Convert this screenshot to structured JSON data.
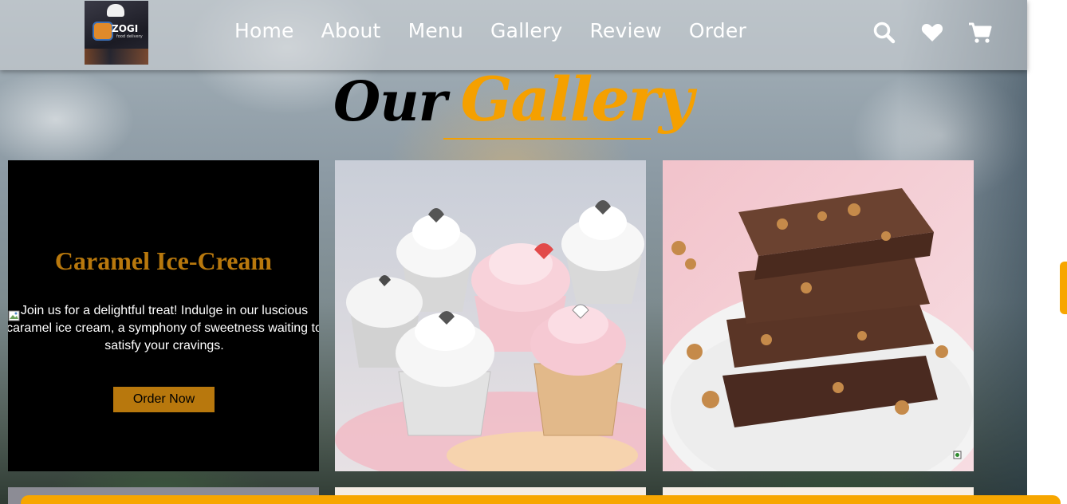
{
  "nav": {
    "links": [
      "Home",
      "About",
      "Menu",
      "Gallery",
      "Review",
      "Order"
    ]
  },
  "header": {
    "logo_text": "ZOGI",
    "logo_sub": "food delivery",
    "icons": [
      "search-icon",
      "heart-icon",
      "cart-icon"
    ]
  },
  "gallery": {
    "title_part1": "Our",
    "title_part2": "Gallery",
    "cards": [
      {
        "title": "Caramel Ice-Cream",
        "text": "Join us for a delightful treat! Indulge in our luscious caramel ice cream, a symphony of sweetness waiting to satisfy your cravings.",
        "button": "Order Now",
        "image": "broken-image-icon"
      },
      {
        "image": "cupcakes-photo"
      },
      {
        "image": "brownies-photo"
      }
    ]
  },
  "colors": {
    "accent": "#f5a000",
    "card_title": "#b8780d",
    "button_bg": "#b8780d",
    "card_bg": "#000000"
  }
}
